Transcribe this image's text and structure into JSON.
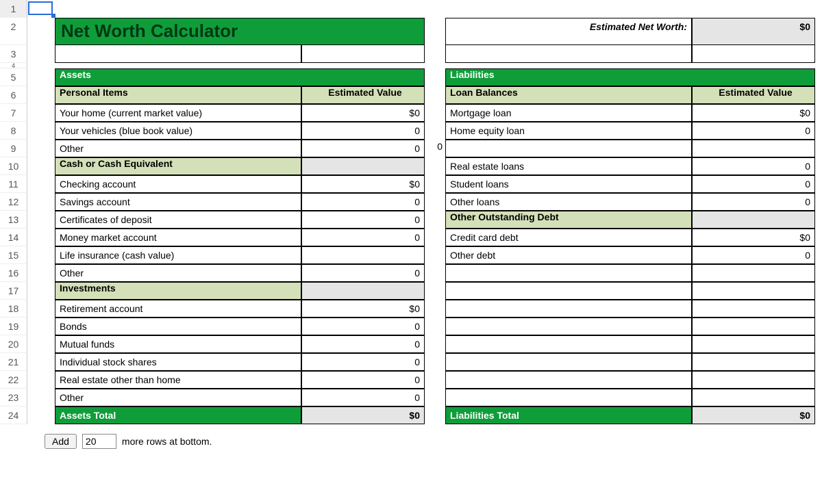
{
  "rownums": [
    "1",
    "2",
    "3",
    "4",
    "5",
    "6",
    "7",
    "8",
    "9",
    "10",
    "11",
    "12",
    "13",
    "14",
    "15",
    "16",
    "17",
    "18",
    "19",
    "20",
    "21",
    "22",
    "23",
    "24"
  ],
  "title": "Net Worth Calculator",
  "netWorth": {
    "label": "Estimated Net Worth:",
    "value": "$0"
  },
  "assets": {
    "header": "Assets",
    "valueHeader": "Estimated Value",
    "groups": [
      {
        "name": "Personal Items",
        "rows": [
          {
            "label": "Your home (current market value)",
            "value": "$0"
          },
          {
            "label": "Your vehicles (blue book value)",
            "value": "0"
          },
          {
            "label": "Other",
            "value": "0"
          }
        ]
      },
      {
        "name": "Cash or Cash Equivalent",
        "rows": [
          {
            "label": "Checking account",
            "value": "$0"
          },
          {
            "label": "Savings account",
            "value": "0"
          },
          {
            "label": "Certificates of deposit",
            "value": "0"
          },
          {
            "label": "Money market account",
            "value": "0"
          },
          {
            "label": "Life insurance (cash value)",
            "value": ""
          },
          {
            "label": "Other",
            "value": "0"
          }
        ]
      },
      {
        "name": "Investments",
        "rows": [
          {
            "label": "Retirement account",
            "value": "$0"
          },
          {
            "label": "Bonds",
            "value": "0"
          },
          {
            "label": "Mutual funds",
            "value": "0"
          },
          {
            "label": "Individual stock shares",
            "value": "0"
          },
          {
            "label": "Real estate other than home",
            "value": "0"
          },
          {
            "label": "Other",
            "value": "0"
          }
        ]
      }
    ],
    "totalLabel": "Assets Total",
    "totalValue": "$0"
  },
  "liab": {
    "header": "Liabilities",
    "valueHeader": "Estimated Value",
    "groups": [
      {
        "name": "Loan Balances",
        "rows": [
          {
            "label": "Mortgage loan",
            "value": "$0"
          },
          {
            "label": "Home equity loan",
            "value": "0"
          },
          {
            "label": "",
            "value": ""
          },
          {
            "label": "Real estate loans",
            "value": "0"
          },
          {
            "label": "Student loans",
            "value": "0"
          },
          {
            "label": "Other loans",
            "value": "0"
          }
        ]
      },
      {
        "name": "Other Outstanding Debt",
        "rows": [
          {
            "label": "Credit card debt",
            "value": "$0"
          },
          {
            "label": "Other debt",
            "value": "0"
          }
        ]
      }
    ],
    "emptyRows": 8,
    "totalLabel": "Liabilities Total",
    "totalValue": "$0"
  },
  "spacerNum": "0",
  "footer": {
    "button": "Add",
    "count": "20",
    "suffix": "more rows at bottom."
  }
}
